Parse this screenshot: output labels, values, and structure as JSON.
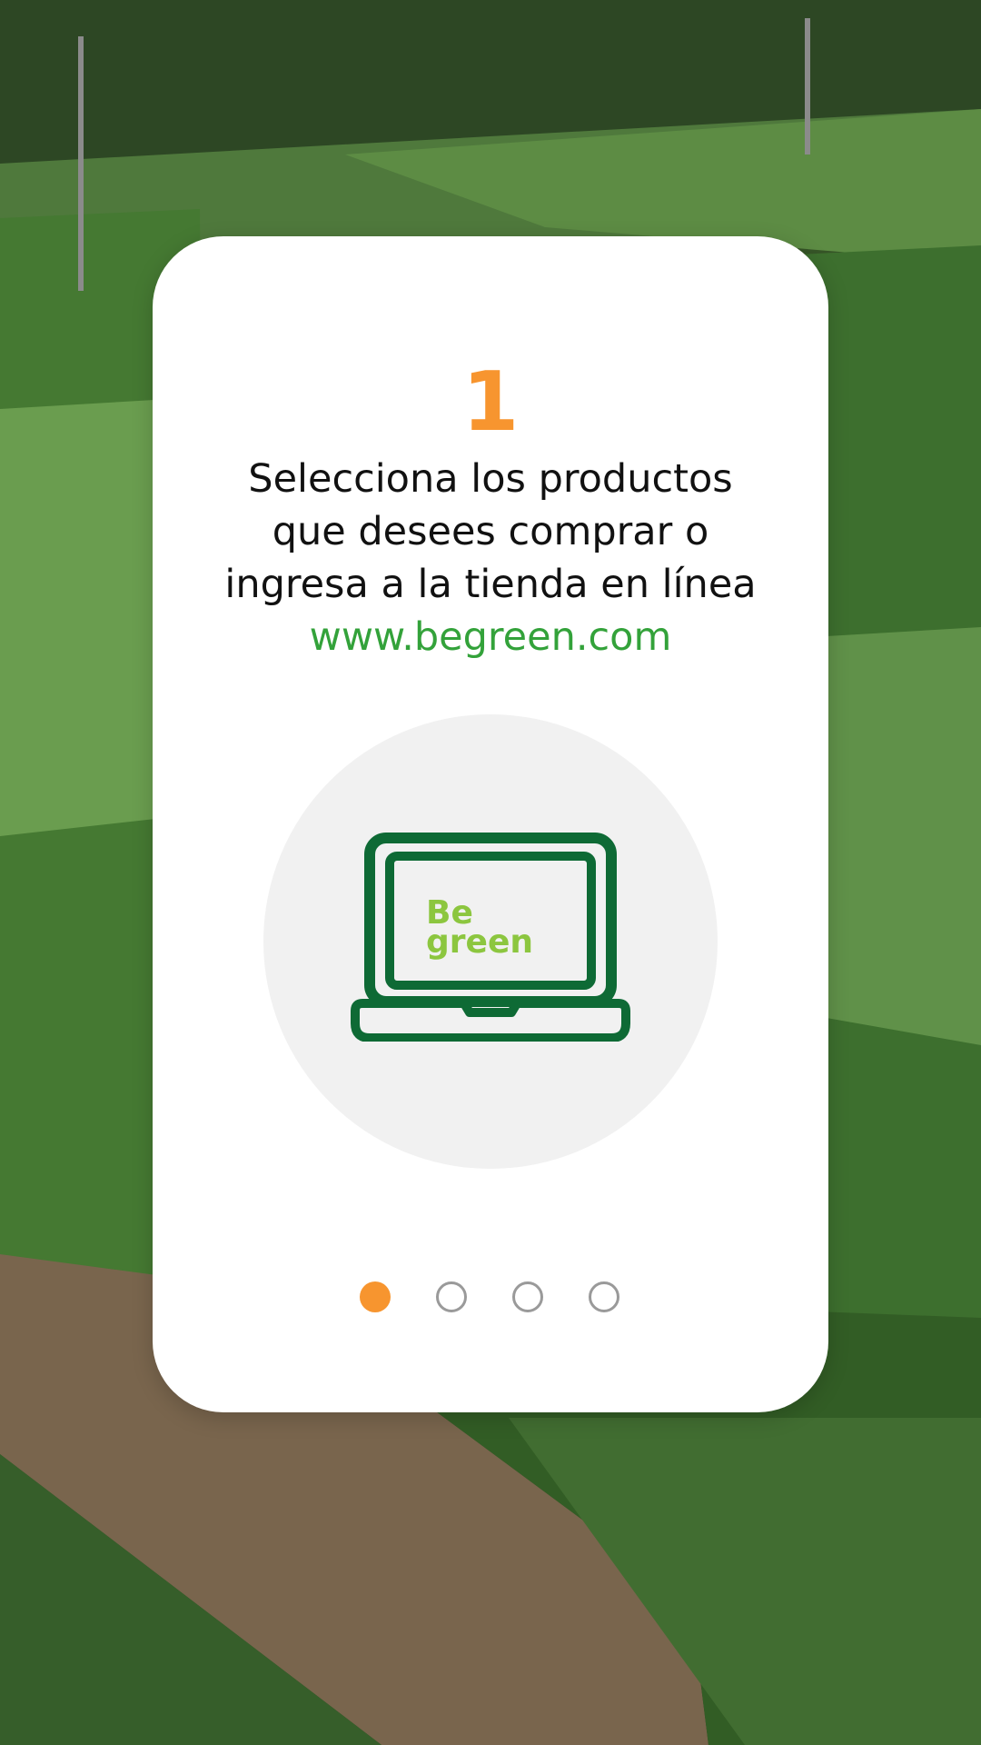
{
  "background": {
    "description_icon": "vegetable-field-background"
  },
  "card": {
    "step_number": "1",
    "text_lines": [
      "Selecciona los productos",
      "que desees comprar o",
      "ingresa a la tienda en línea"
    ],
    "link_text": "www.begreen.com",
    "illustration": {
      "icon": "laptop-icon",
      "logo_line1": "Be",
      "logo_line2": "green"
    }
  },
  "pagination": {
    "total": 4,
    "active_index": 0
  },
  "colors": {
    "accent_orange": "#f7952f",
    "link_green": "#33a23a",
    "laptop_green": "#0e6a35",
    "logo_lime": "#8cc63f",
    "circle_grey": "#f1f1f1"
  }
}
